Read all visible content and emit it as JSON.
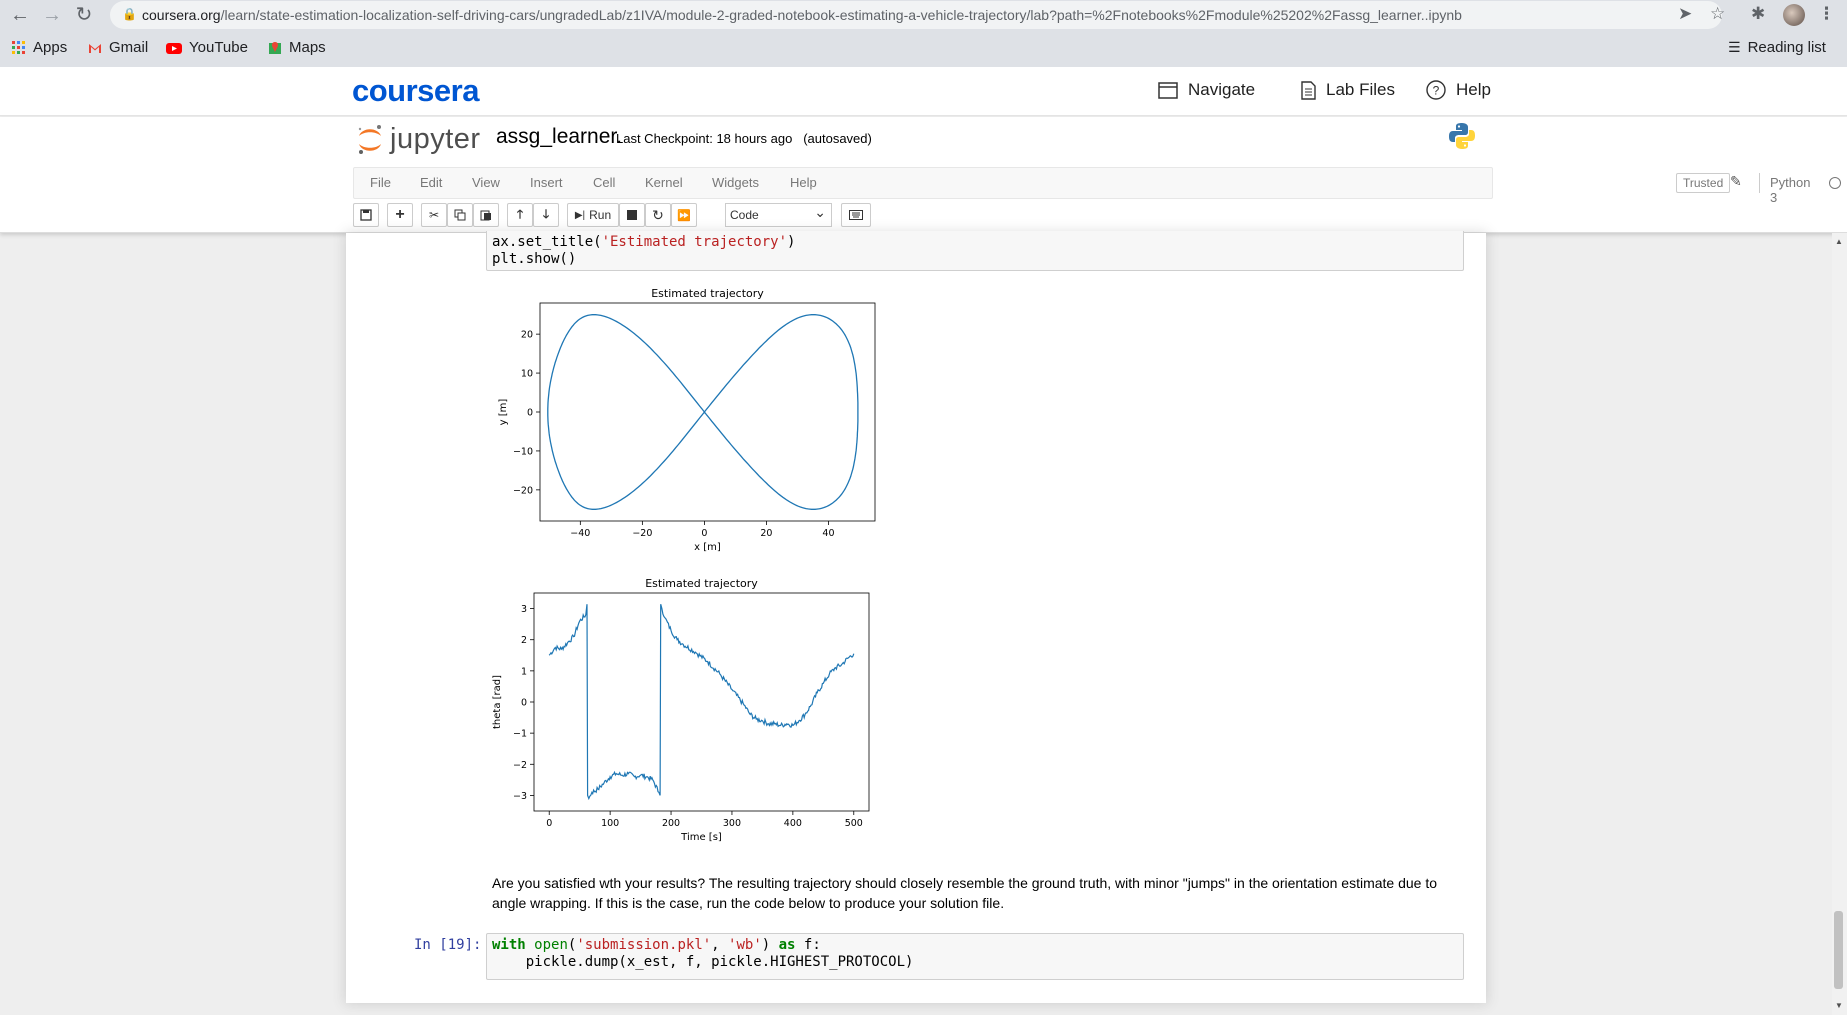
{
  "browser": {
    "url_host": "coursera.org",
    "url_path": "/learn/state-estimation-localization-self-driving-cars/ungradedLab/z1IVA/module-2-graded-notebook-estimating-a-vehicle-trajectory/lab?path=%2Fnotebooks%2Fmodule%25202%2Fassg_learner..ipynb",
    "bookmarks": [
      "Apps",
      "Gmail",
      "YouTube",
      "Maps"
    ],
    "reading_list": "Reading list"
  },
  "coursera": {
    "logo": "coursera",
    "navigate": "Navigate",
    "lab_files": "Lab Files",
    "help": "Help"
  },
  "jupyter": {
    "logo_text": "jupyter",
    "notebook_name": "assg_learner.",
    "checkpoint": "Last Checkpoint: 18 hours ago",
    "autosaved": "(autosaved)",
    "menu": [
      "File",
      "Edit",
      "View",
      "Insert",
      "Cell",
      "Kernel",
      "Widgets",
      "Help"
    ],
    "trusted": "Trusted",
    "kernel": "Python 3",
    "run_label": "Run",
    "cell_type": "Code"
  },
  "cells": {
    "top_code_line1_a": "ax.set_title(",
    "top_code_line1_str": "'Estimated trajectory'",
    "top_code_line1_b": ")",
    "top_code_line2": "plt.show()",
    "markdown": "Are you satisfied wth your results? The resulting trajectory should closely resemble the ground truth, with minor \"jumps\" in the orientation estimate due to angle wrapping. If this is the case, run the code below to produce your solution file.",
    "prompt": "In [19]:",
    "code_kw_with": "with",
    "code_open": "open",
    "code_l1_a": "(",
    "code_str1": "'submission.pkl'",
    "code_l1_b": ", ",
    "code_str2": "'wb'",
    "code_l1_c": ") ",
    "code_kw_as": "as",
    "code_l1_d": " f:",
    "code_line2": "    pickle.dump(x_est, f, pickle.HIGHEST_PROTOCOL)"
  },
  "chart_data": [
    {
      "type": "line",
      "title": "Estimated trajectory",
      "xlabel": "x [m]",
      "ylabel": "y [m]",
      "xlim": [
        -53,
        55
      ],
      "ylim": [
        -28,
        28
      ],
      "xticks": [
        -40,
        -20,
        0,
        20,
        40
      ],
      "yticks": [
        -20,
        -10,
        0,
        10,
        20
      ],
      "series": [
        {
          "color": "#1f77b4",
          "shape": "figure-eight",
          "x_amplitude": 50,
          "y_amplitude": 25
        }
      ]
    },
    {
      "type": "line",
      "title": "Estimated trajectory",
      "xlabel": "Time [s]",
      "ylabel": "theta [rad]",
      "xlim": [
        -25,
        525
      ],
      "ylim": [
        -3.5,
        3.5
      ],
      "xticks": [
        0,
        100,
        200,
        300,
        400,
        500
      ],
      "yticks": [
        -3,
        -2,
        -1,
        0,
        1,
        2,
        3
      ],
      "series": [
        {
          "color": "#1f77b4",
          "x": [
            0,
            10,
            20,
            30,
            40,
            50,
            60,
            62,
            63,
            65,
            70,
            80,
            90,
            100,
            110,
            120,
            130,
            140,
            150,
            160,
            170,
            180,
            182,
            183,
            185,
            190,
            200,
            210,
            220,
            240,
            260,
            280,
            300,
            320,
            330,
            340,
            350,
            360,
            370,
            380,
            390,
            400,
            410,
            420,
            430,
            440,
            450,
            460,
            470,
            480,
            490,
            500
          ],
          "y": [
            1.5,
            1.75,
            1.7,
            1.9,
            2.1,
            2.6,
            2.8,
            3.14,
            -3.0,
            -3.1,
            -2.9,
            -2.8,
            -2.6,
            -2.4,
            -2.3,
            -2.35,
            -2.3,
            -2.4,
            -2.35,
            -2.4,
            -2.5,
            -2.9,
            -3.0,
            3.14,
            3.0,
            2.7,
            2.3,
            2.0,
            1.85,
            1.6,
            1.3,
            0.9,
            0.4,
            -0.1,
            -0.4,
            -0.55,
            -0.6,
            -0.7,
            -0.7,
            -0.75,
            -0.7,
            -0.75,
            -0.6,
            -0.4,
            -0.1,
            0.3,
            0.6,
            0.9,
            1.1,
            1.2,
            1.4,
            1.55
          ]
        }
      ]
    }
  ]
}
